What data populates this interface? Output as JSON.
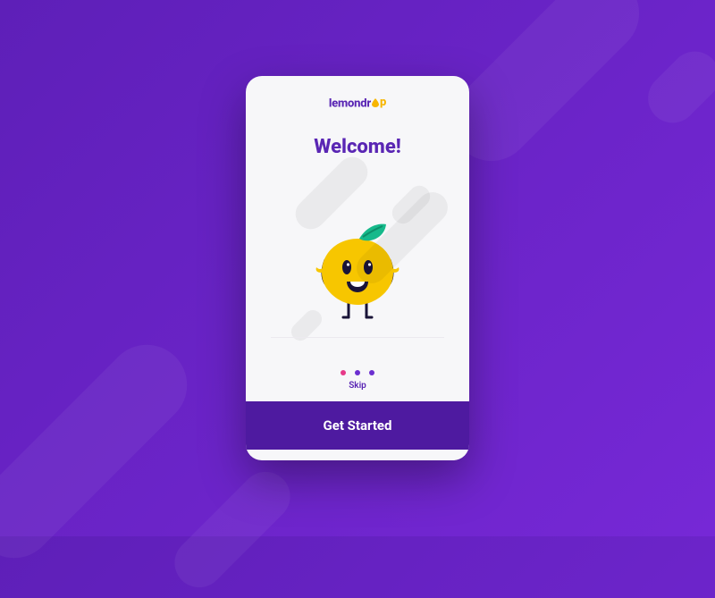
{
  "brand": {
    "prefix": "lemondr",
    "suffix": "p",
    "accent_color": "#f7b500",
    "primary_color": "#5a26b4"
  },
  "welcome_title": "Welcome!",
  "pager": {
    "total": 3,
    "active_index": 0,
    "active_color": "#e63988",
    "idle_color": "#6b2fd0"
  },
  "skip_label": "Skip",
  "cta_label": "Get Started"
}
